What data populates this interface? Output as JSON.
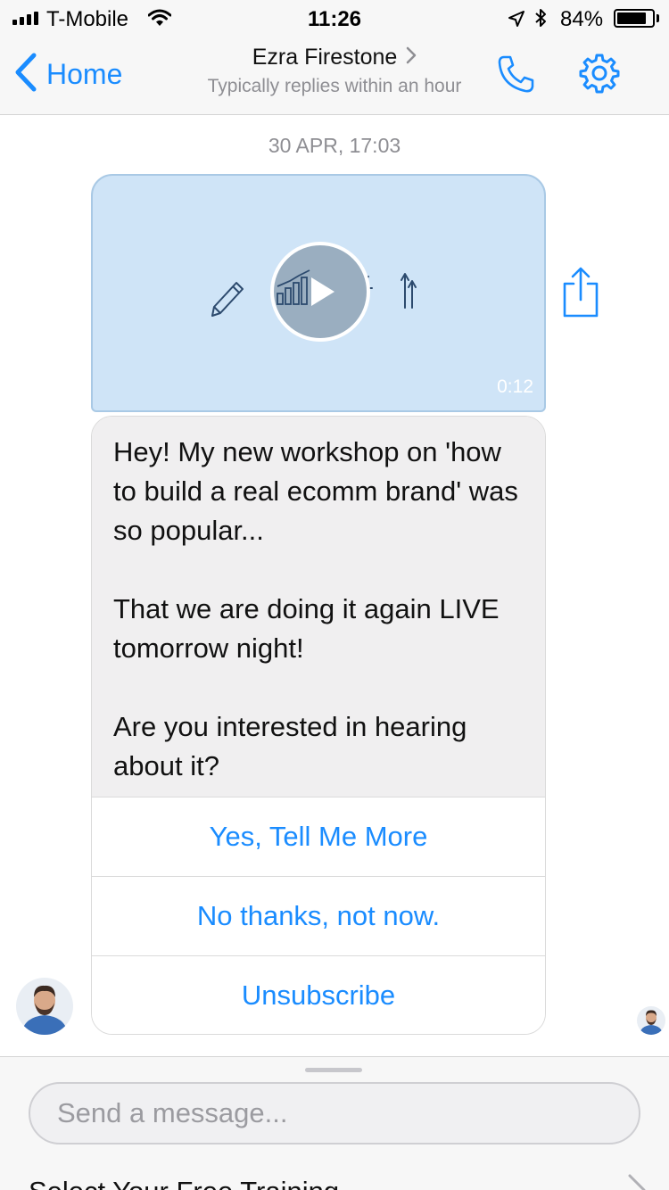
{
  "status_bar": {
    "carrier": "T-Mobile",
    "time": "11:26",
    "battery_percent": "84%",
    "battery_level": 0.84,
    "signal_bars": 4,
    "icons": [
      "signal-icon",
      "wifi-icon",
      "location-icon",
      "bluetooth-icon",
      "battery-icon"
    ]
  },
  "nav": {
    "back_label": "Home",
    "contact_name": "Ezra Firestone",
    "contact_subtitle": "Typically replies within an hour",
    "icons": [
      "chevron-left-icon",
      "chevron-right-icon",
      "phone-icon",
      "gear-icon"
    ]
  },
  "chat": {
    "timestamp": "30 APR, 17:03",
    "video": {
      "duration": "0:12",
      "icons": [
        "pencil-icon",
        "bar-chart-icon",
        "play-icon",
        "lightbulb-icon",
        "arrows-up-icon"
      ]
    },
    "share_icon": "share-icon",
    "message_paragraphs": [
      "Hey! My new workshop on 'how to build a real ecomm brand' was so popular...",
      "That we are doing it again LIVE tomorrow night!",
      "Are you interested in hearing about it?"
    ],
    "quick_replies": [
      "Yes, Tell Me More",
      "No thanks, not now.",
      "Unsubscribe"
    ]
  },
  "composer": {
    "placeholder": "Send a message...",
    "menu_label": "Select Your Free Training"
  },
  "colors": {
    "accent": "#1a8cff",
    "bar_background": "#f7f7f7",
    "bubble_gray": "#f0eff0",
    "video_blue": "#cfe4f7",
    "muted_text": "#8e8e93"
  }
}
